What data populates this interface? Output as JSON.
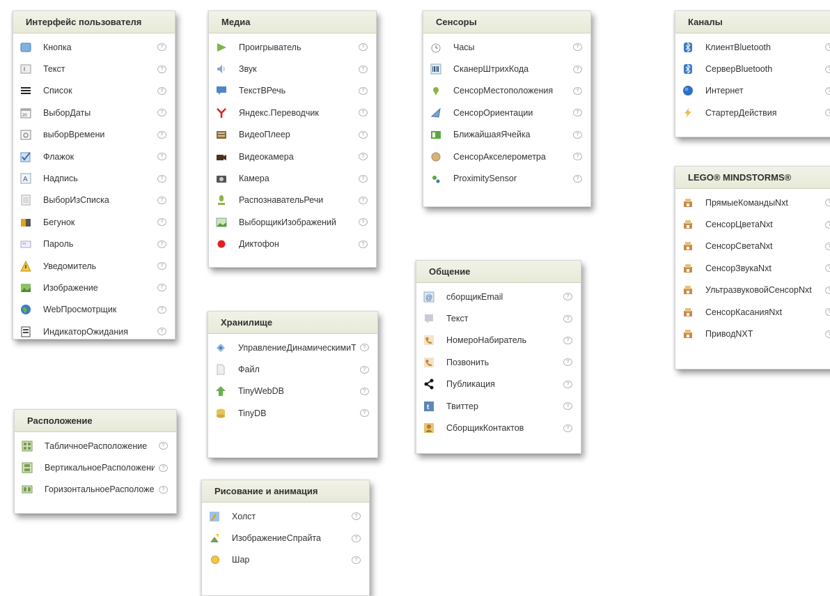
{
  "panels": {
    "ui": {
      "title": "Интерфейс пользователя",
      "items": [
        {
          "label": "Кнопка",
          "icon": "button-icon"
        },
        {
          "label": "Текст",
          "icon": "textbox-icon"
        },
        {
          "label": "Список",
          "icon": "list-icon"
        },
        {
          "label": "ВыборДаты",
          "icon": "datepicker-icon"
        },
        {
          "label": "выборВремени",
          "icon": "timepicker-icon"
        },
        {
          "label": "Флажок",
          "icon": "checkbox-icon"
        },
        {
          "label": "Надпись",
          "icon": "label-icon"
        },
        {
          "label": "ВыборИзСписка",
          "icon": "listpicker-icon"
        },
        {
          "label": "Бегунок",
          "icon": "slider-icon"
        },
        {
          "label": "Пароль",
          "icon": "password-icon"
        },
        {
          "label": "Уведомитель",
          "icon": "notifier-icon"
        },
        {
          "label": "Изображение",
          "icon": "image-icon"
        },
        {
          "label": "WebПросмотрщик",
          "icon": "webviewer-icon"
        },
        {
          "label": "ИндикаторОжидания",
          "icon": "spinner-icon"
        }
      ]
    },
    "media": {
      "title": "Медиа",
      "items": [
        {
          "label": "Проигрыватель",
          "icon": "player-icon"
        },
        {
          "label": "Звук",
          "icon": "sound-icon"
        },
        {
          "label": "ТекстВРечь",
          "icon": "text-to-speech-icon"
        },
        {
          "label": "Яндекс.Переводчик",
          "icon": "yandex-translate-icon"
        },
        {
          "label": "ВидеоПлеер",
          "icon": "video-player-icon"
        },
        {
          "label": "Видеокамера",
          "icon": "camcorder-icon"
        },
        {
          "label": "Камера",
          "icon": "camera-icon"
        },
        {
          "label": "РаспознавательРечи",
          "icon": "speech-recognizer-icon"
        },
        {
          "label": "ВыборщикИзображений",
          "icon": "image-picker-icon"
        },
        {
          "label": "Диктофон",
          "icon": "recorder-icon"
        }
      ]
    },
    "sensors": {
      "title": "Сенсоры",
      "items": [
        {
          "label": "Часы",
          "icon": "clock-icon"
        },
        {
          "label": "СканерШтрихКода",
          "icon": "barcode-scanner-icon"
        },
        {
          "label": "СенсорМестоположения",
          "icon": "location-sensor-icon"
        },
        {
          "label": "СенсорОриентации",
          "icon": "orientation-sensor-icon"
        },
        {
          "label": "БлижайшаяЯчейка",
          "icon": "near-field-icon"
        },
        {
          "label": "СенсорАкселерометра",
          "icon": "accelerometer-icon"
        },
        {
          "label": "ProximitySensor",
          "icon": "proximity-sensor-icon"
        }
      ]
    },
    "connectivity": {
      "title": "Каналы",
      "items": [
        {
          "label": "КлиентBluetooth",
          "icon": "bluetooth-client-icon"
        },
        {
          "label": "СерверBluetooth",
          "icon": "bluetooth-server-icon"
        },
        {
          "label": "Интернет",
          "icon": "globe-icon"
        },
        {
          "label": "СтартерДействия",
          "icon": "activity-starter-icon"
        }
      ]
    },
    "lego": {
      "title": "LEGO® MINDSTORMS®",
      "items": [
        {
          "label": "ПрямыеКомандыNxt",
          "icon": "lego-brick-icon"
        },
        {
          "label": "СенсорЦветаNxt",
          "icon": "lego-brick-icon"
        },
        {
          "label": "СенсорСветаNxt",
          "icon": "lego-brick-icon"
        },
        {
          "label": "СенсорЗвукаNxt",
          "icon": "lego-brick-icon"
        },
        {
          "label": "УльтразвуковойСенсорNxt",
          "icon": "lego-brick-icon"
        },
        {
          "label": "СенсорКасанияNxt",
          "icon": "lego-brick-icon"
        },
        {
          "label": "ПриводNXT",
          "icon": "lego-brick-icon"
        }
      ]
    },
    "social": {
      "title": "Общение",
      "items": [
        {
          "label": "сборщикEmail",
          "icon": "email-picker-icon"
        },
        {
          "label": "Текст",
          "icon": "texting-icon"
        },
        {
          "label": "НомероНабиратель",
          "icon": "phone-number-picker-icon"
        },
        {
          "label": "Позвонить",
          "icon": "phone-call-icon"
        },
        {
          "label": "Публикация",
          "icon": "share-icon"
        },
        {
          "label": "Твиттер",
          "icon": "twitter-icon"
        },
        {
          "label": "СборщикКонтактов",
          "icon": "contact-picker-icon"
        }
      ]
    },
    "storage": {
      "title": "Хранилище",
      "items": [
        {
          "label": "УправлениеДинамическимиТабл",
          "icon": "fusion-tables-icon"
        },
        {
          "label": "Файл",
          "icon": "file-icon"
        },
        {
          "label": "TinyWebDB",
          "icon": "tinywebdb-icon"
        },
        {
          "label": "TinyDB",
          "icon": "tinydb-icon"
        }
      ]
    },
    "layout": {
      "title": "Расположение",
      "items": [
        {
          "label": "ТабличноеРасположение",
          "icon": "table-arrangement-icon"
        },
        {
          "label": "ВертикальноеРасположение",
          "icon": "vertical-arrangement-icon"
        },
        {
          "label": "ГоризонтальноеРасположение",
          "icon": "horizontal-arrangement-icon"
        }
      ]
    },
    "drawing": {
      "title": "Рисование и анимация",
      "items": [
        {
          "label": "Холст",
          "icon": "canvas-icon"
        },
        {
          "label": "ИзображениеСпрайта",
          "icon": "image-sprite-icon"
        },
        {
          "label": "Шар",
          "icon": "ball-icon"
        }
      ]
    }
  }
}
